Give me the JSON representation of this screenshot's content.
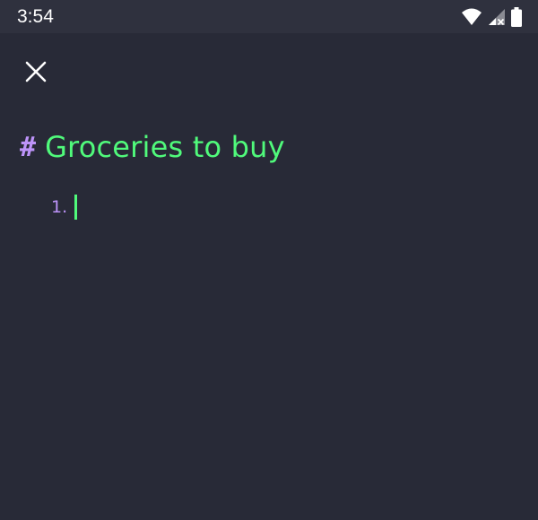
{
  "status_bar": {
    "time": "3:54",
    "icons": [
      "wifi-icon",
      "cell-signal-icon",
      "battery-icon"
    ]
  },
  "toolbar": {
    "close_icon": "close-icon"
  },
  "editor": {
    "heading_marker": "#",
    "heading_text": "Groceries to buy",
    "list_number": "1.",
    "list_item_text": ""
  },
  "colors": {
    "background": "#282a37",
    "status_bar": "#2f313e",
    "heading_marker": "#bd93f9",
    "heading_text": "#50fa7b",
    "list_number": "#bd93f9",
    "caret": "#50fa7b",
    "icon": "#ffffff"
  }
}
